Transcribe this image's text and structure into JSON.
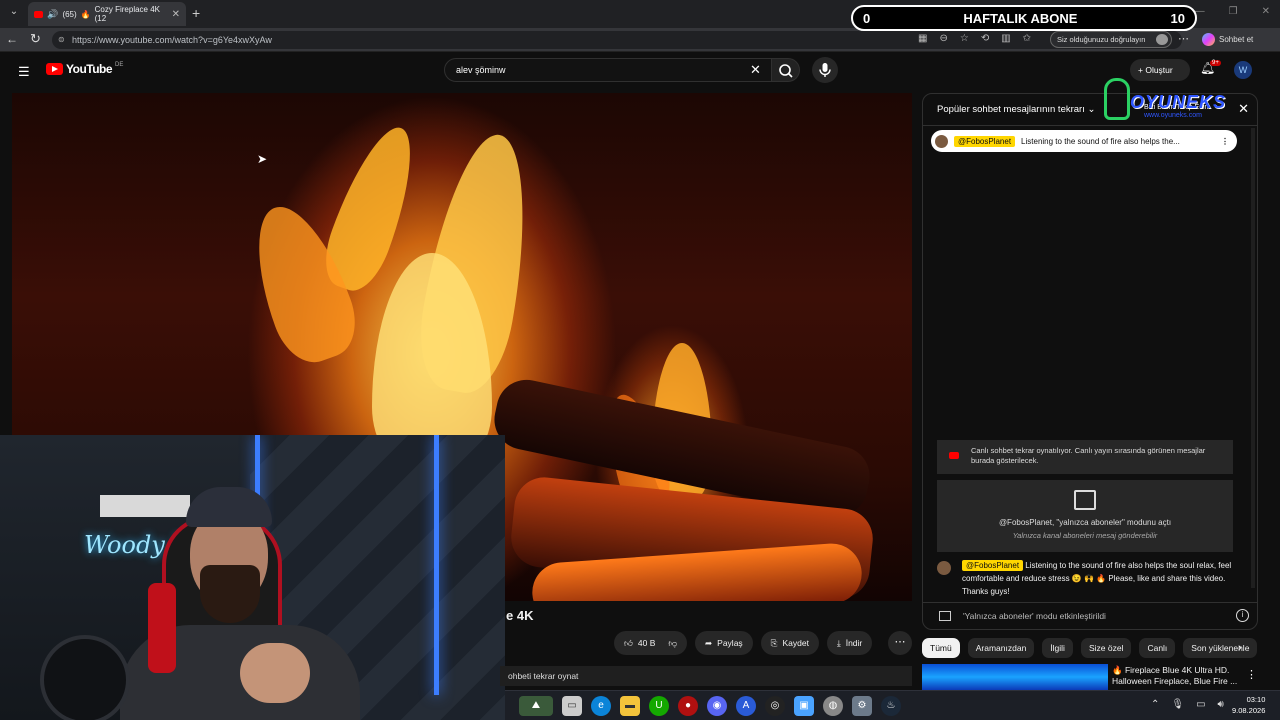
{
  "browser": {
    "tab_count_prefix": "(65)",
    "tab_title": "Cozy Fireplace 4K (12",
    "url": "https://www.youtube.com/watch?v=g6Ye4xwXyAw",
    "verify_label": "Siz olduğunuzu doğrulayın",
    "copilot_label": "Sohbet et"
  },
  "overlay": {
    "weekly_sub_label": "HAFTALIK ABONE",
    "weekly_sub_current": "0",
    "weekly_sub_goal": "10",
    "logo_text": "OYUNEKS",
    "logo_subtext": "www.oyuneks.com",
    "logo_follow": "Bizi Bizim Takip Edin"
  },
  "youtube": {
    "logo_text": "YouTube",
    "region": "DE",
    "search_value": "alev şöminw",
    "create_label": "Oluştur",
    "notif_badge": "9+"
  },
  "video": {
    "title_tail": "e 4K",
    "like_count": "40 B",
    "share_label": "Paylaş",
    "save_label": "Kaydet",
    "download_label": "İndir",
    "replay_label": "ohbeti tekrar oynat"
  },
  "webcam": {
    "sign_text": "Woody Wa"
  },
  "chat": {
    "header_title": "Popüler sohbet mesajlarının tekrarı",
    "pinned_user": "@FobosPlanet",
    "pinned_text": "Listening to the sound of fire also helps the...",
    "system_line1": "Canlı sohbet tekrar oynatılıyor. Canlı yayın sırasında görünen mesajlar",
    "system_line2": "burada gösterilecek.",
    "mode_title": "@FobosPlanet, \"yalnızca aboneler\" modunu açtı",
    "mode_sub": "Yalnızca kanal aboneleri mesaj gönderebilir",
    "message_user": "@FobosPlanet",
    "message_text": "Listening to the sound of fire also helps the soul relax, feel comfortable and reduce stress 😉 🙌 🔥 Please, like and share this video. Thanks guys!",
    "footer_text": "'Yalnızca aboneler' modu etkinleştirildi"
  },
  "chips": [
    "Tümü",
    "Aramanızdan",
    "İlgili",
    "Size özel",
    "Canlı",
    "Son yüklenenle"
  ],
  "recommendation": {
    "title": "🔥 Fireplace Blue 4K Ultra HD. Halloween Fireplace, Blue Fire ..."
  },
  "taskbar": {
    "time": "03:10",
    "date": "9.08.2026"
  },
  "colors": {
    "youtube_red": "#ff0000",
    "chip_selected": "#f1f1f1",
    "username_chip": "#ffd600",
    "neon_blue": "#3c7dff"
  }
}
